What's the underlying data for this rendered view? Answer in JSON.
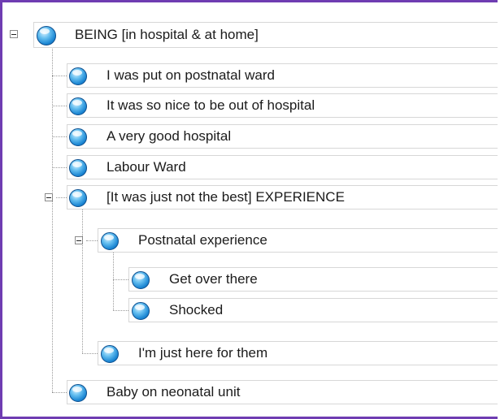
{
  "tree": {
    "root": {
      "label": "BEING [in hospital & at home]",
      "expanded": true
    },
    "children": [
      {
        "label": "I was put on postnatal ward"
      },
      {
        "label": "It was so nice to be out of hospital"
      },
      {
        "label": "A very good hospital"
      },
      {
        "label": "Labour Ward"
      },
      {
        "label": "[It was just not the best] EXPERIENCE",
        "expanded": true
      },
      {
        "label": "Postnatal experience",
        "expanded": true
      },
      {
        "label": "Get over there"
      },
      {
        "label": "Shocked"
      },
      {
        "label": "I'm just here for them"
      },
      {
        "label": "Baby on neonatal unit"
      }
    ]
  },
  "colors": {
    "frame": "#6f3db2",
    "icon": "#1b86d3",
    "connector": "#9a9a9a"
  },
  "icon_name": "node-circle-icon"
}
